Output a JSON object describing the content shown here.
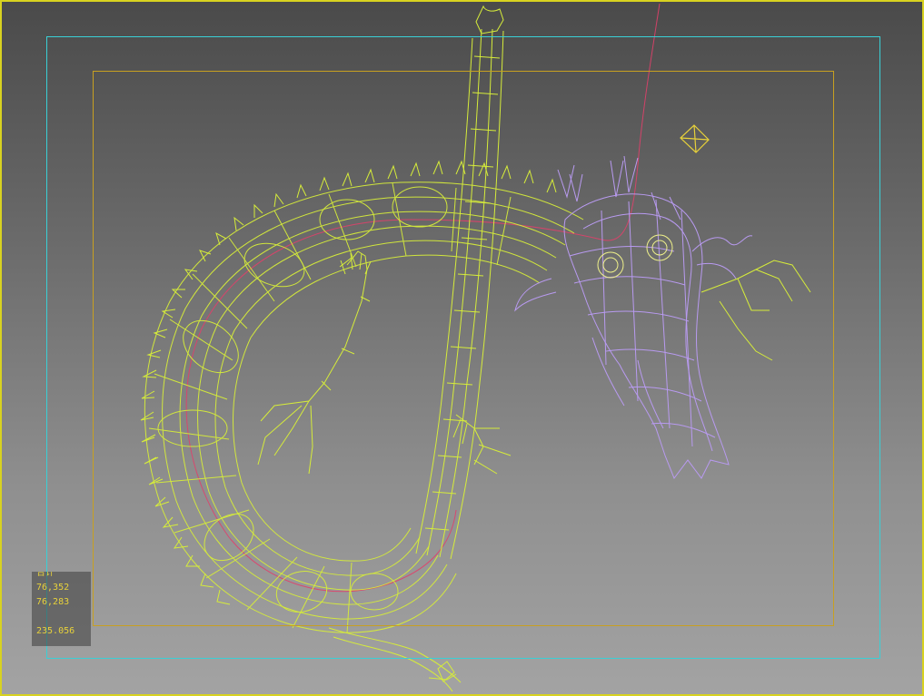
{
  "viewport": {
    "background_top": "#4a4a4a",
    "background_bottom": "#a3a3a3",
    "active_border_color": "#d8d220"
  },
  "frames": {
    "safe_frame_color": "#39d0d6",
    "action_safe_color": "#c8a020"
  },
  "scene": {
    "dragon_body_color": "#d6ec3a",
    "dragon_head_color": "#b89af0",
    "spline_color": "#e0406a",
    "light_icon": "light-gizmo-icon"
  },
  "stats": {
    "header": "合计",
    "polys": "76,352",
    "verts": "76,283",
    "fps": "235.056"
  }
}
